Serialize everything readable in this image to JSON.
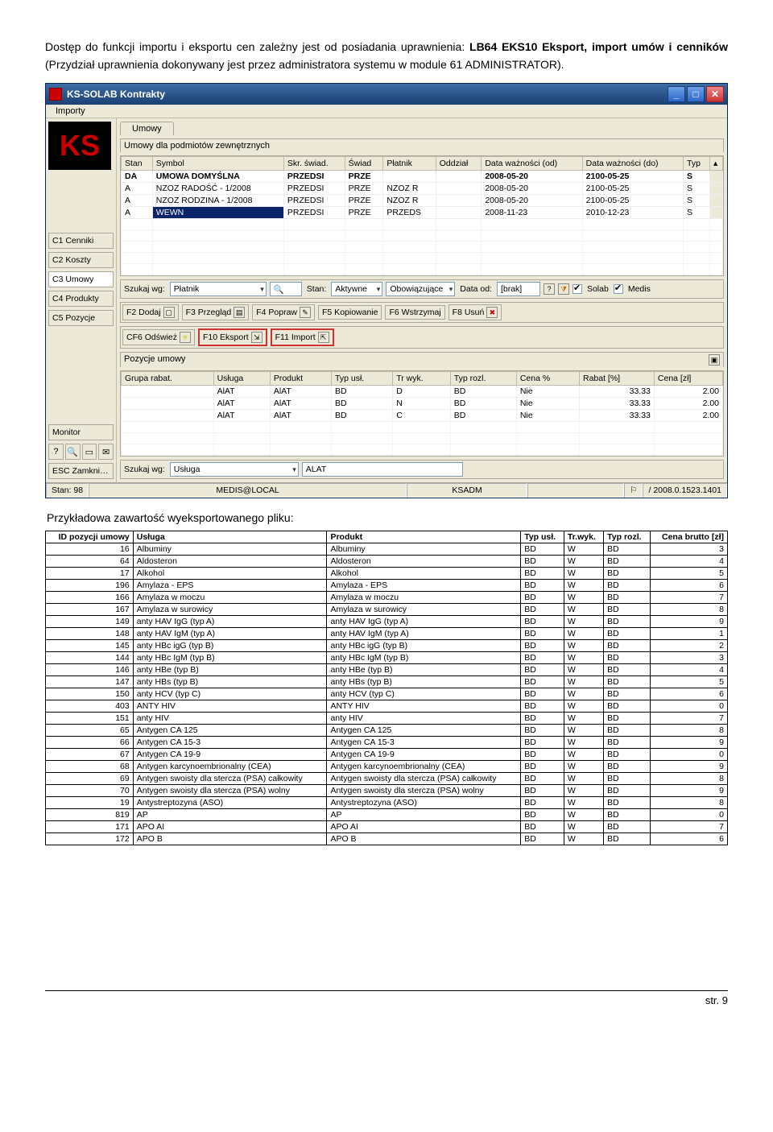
{
  "intro": {
    "pre": "Dostęp do funkcji importu i eksportu cen zależny jest od posiadania uprawnienia: ",
    "b1": "LB64 EKS10 Eksport, import umów i cenników",
    "post": " (Przydział uprawnienia dokonywany jest przez administratora systemu w module 61 ADMINISTRATOR)."
  },
  "win": {
    "title": "KS-SOLAB Kontrakty",
    "menu": "Importy",
    "sidebar": [
      "C1 Cenniki",
      "C2 Koszty",
      "C3 Umowy",
      "C4 Produkty",
      "C5 Pozycje"
    ],
    "monitor": "Monitor",
    "esc": "ESC Zamknij",
    "tab": "Umowy",
    "panel1": "Umowy dla podmiotów zewnętrznych",
    "cols1": [
      "Stan",
      "Symbol",
      "Skr. świad.",
      "Świad",
      "Płatnik",
      "Oddział",
      "Data ważności (od)",
      "Data ważności (do)",
      "Typ"
    ],
    "rows1": [
      {
        "stan": "DA",
        "sym": "UMOWA DOMYŚLNA",
        "skr": "PRZEDSI",
        "sw": "PRZE",
        "pl": "",
        "od": "",
        "dod": "2008-05-20",
        "ddo": "2100-05-25",
        "typ": "S",
        "hl": true
      },
      {
        "stan": "A",
        "sym": "NZOZ RADOŚĆ - 1/2008",
        "skr": "PRZEDSI",
        "sw": "PRZE",
        "pl": "NZOZ R",
        "od": "",
        "dod": "2008-05-20",
        "ddo": "2100-05-25",
        "typ": "S"
      },
      {
        "stan": "A",
        "sym": "NZOZ RODZINA - 1/2008",
        "skr": "PRZEDSI",
        "sw": "PRZE",
        "pl": "NZOZ R",
        "od": "",
        "dod": "2008-05-20",
        "ddo": "2100-05-25",
        "typ": "S"
      },
      {
        "stan": "A",
        "sym": "WEWN",
        "skr": "PRZEDSI",
        "sw": "PRZE",
        "pl": "PRZEDS",
        "od": "",
        "dod": "2008-11-23",
        "ddo": "2010-12-23",
        "typ": "S",
        "sel": true
      }
    ],
    "filter": {
      "lbl_search": "Szukaj wg:",
      "search_by": "Płatnik",
      "lbl_stan": "Stan:",
      "stan": "Aktywne",
      "obow": "Obowiązujące",
      "lbl_data": "Data od:",
      "data": "[brak]",
      "solab": "Solab",
      "medis": "Medis"
    },
    "btns": {
      "f2": "F2 Dodaj",
      "f3": "F3 Przegląd",
      "f4": "F4 Popraw",
      "f5": "F5 Kopiowanie",
      "f6": "F6 Wstrzymaj",
      "f8": "F8 Usuń",
      "cf6": "CF6 Odśwież",
      "f10": "F10 Eksport",
      "f11": "F11 Import"
    },
    "panel2": "Pozycje umowy",
    "cols2": [
      "Grupa rabat.",
      "Usługa",
      "Produkt",
      "Typ usł.",
      "Tr wyk.",
      "Typ rozl.",
      "Cena %",
      "Rabat [%]",
      "Cena [zł]"
    ],
    "rows2": [
      {
        "gr": "",
        "us": "AlAT",
        "pr": "AlAT",
        "tu": "BD",
        "tw": "D",
        "tr": "BD",
        "cp": "Nie",
        "rb": "33.33",
        "cz": "2.00"
      },
      {
        "gr": "",
        "us": "AlAT",
        "pr": "AlAT",
        "tu": "BD",
        "tw": "N",
        "tr": "BD",
        "cp": "Nie",
        "rb": "33.33",
        "cz": "2.00"
      },
      {
        "gr": "",
        "us": "AlAT",
        "pr": "AlAT",
        "tu": "BD",
        "tw": "C",
        "tr": "BD",
        "cp": "Nie",
        "rb": "33.33",
        "cz": "2.00"
      }
    ],
    "filter2": {
      "lbl": "Szukaj wg:",
      "by": "Usługa",
      "val": "ALAT"
    },
    "status": {
      "stan": "Stan: 98",
      "user": "MEDIS@LOCAL",
      "ks": "KSADM",
      "ver": "/ 2008.0.1523.1401"
    }
  },
  "caption2": "Przykładowa zawartość wyeksportowanego pliku:",
  "exp": {
    "cols": [
      "ID pozycji umowy",
      "Usługa",
      "Produkt",
      "Typ usł.",
      "Tr.wyk.",
      "Typ rozl.",
      "Cena brutto [zł]"
    ],
    "rows": [
      [
        "16",
        "Albuminy",
        "Albuminy",
        "BD",
        "W",
        "BD",
        "3"
      ],
      [
        "64",
        "Aldosteron",
        "Aldosteron",
        "BD",
        "W",
        "BD",
        "4"
      ],
      [
        "17",
        "Alkohol",
        "Alkohol",
        "BD",
        "W",
        "BD",
        "5"
      ],
      [
        "196",
        "Amylaza - EPS",
        "Amylaza - EPS",
        "BD",
        "W",
        "BD",
        "6"
      ],
      [
        "166",
        "Amylaza w moczu",
        "Amylaza w moczu",
        "BD",
        "W",
        "BD",
        "7"
      ],
      [
        "167",
        "Amylaza w surowicy",
        "Amylaza w surowicy",
        "BD",
        "W",
        "BD",
        "8"
      ],
      [
        "149",
        "anty HAV IgG (typ A)",
        "anty HAV IgG (typ A)",
        "BD",
        "W",
        "BD",
        "9"
      ],
      [
        "148",
        "anty HAV IgM (typ A)",
        "anty HAV IgM (typ A)",
        "BD",
        "W",
        "BD",
        "1"
      ],
      [
        "145",
        "anty HBc igG (typ B)",
        "anty HBc igG (typ B)",
        "BD",
        "W",
        "BD",
        "2"
      ],
      [
        "144",
        "anty HBc IgM (typ B)",
        "anty HBc IgM (typ B)",
        "BD",
        "W",
        "BD",
        "3"
      ],
      [
        "146",
        "anty HBe (typ B)",
        "anty HBe (typ B)",
        "BD",
        "W",
        "BD",
        "4"
      ],
      [
        "147",
        "anty HBs (typ B)",
        "anty HBs (typ B)",
        "BD",
        "W",
        "BD",
        "5"
      ],
      [
        "150",
        "anty HCV (typ C)",
        "anty HCV (typ C)",
        "BD",
        "W",
        "BD",
        "6"
      ],
      [
        "403",
        "ANTY HIV",
        "ANTY HIV",
        "BD",
        "W",
        "BD",
        "0"
      ],
      [
        "151",
        "anty HIV",
        "anty HIV",
        "BD",
        "W",
        "BD",
        "7"
      ],
      [
        "65",
        "Antygen CA 125",
        "Antygen CA 125",
        "BD",
        "W",
        "BD",
        "8"
      ],
      [
        "66",
        "Antygen CA 15-3",
        "Antygen CA 15-3",
        "BD",
        "W",
        "BD",
        "9"
      ],
      [
        "67",
        "Antygen CA 19-9",
        "Antygen CA 19-9",
        "BD",
        "W",
        "BD",
        "0"
      ],
      [
        "68",
        "Antygen karcynoembrionalny (CEA)",
        "Antygen karcynoembrionalny (CEA)",
        "BD",
        "W",
        "BD",
        "9"
      ],
      [
        "69",
        "Antygen swoisty dla stercza (PSA) całkowity",
        "Antygen swoisty dla stercza (PSA) całkowity",
        "BD",
        "W",
        "BD",
        "8"
      ],
      [
        "70",
        "Antygen swoisty dla stercza (PSA) wolny",
        "Antygen swoisty dla stercza (PSA) wolny",
        "BD",
        "W",
        "BD",
        "9"
      ],
      [
        "19",
        "Antystreptozyna (ASO)",
        "Antystreptozyna (ASO)",
        "BD",
        "W",
        "BD",
        "8"
      ],
      [
        "819",
        "AP",
        "AP",
        "BD",
        "W",
        "BD",
        "0"
      ],
      [
        "171",
        "APO AI",
        "APO AI",
        "BD",
        "W",
        "BD",
        "7"
      ],
      [
        "172",
        "APO B",
        "APO B",
        "BD",
        "W",
        "BD",
        "6"
      ]
    ]
  },
  "footer": "str. 9"
}
